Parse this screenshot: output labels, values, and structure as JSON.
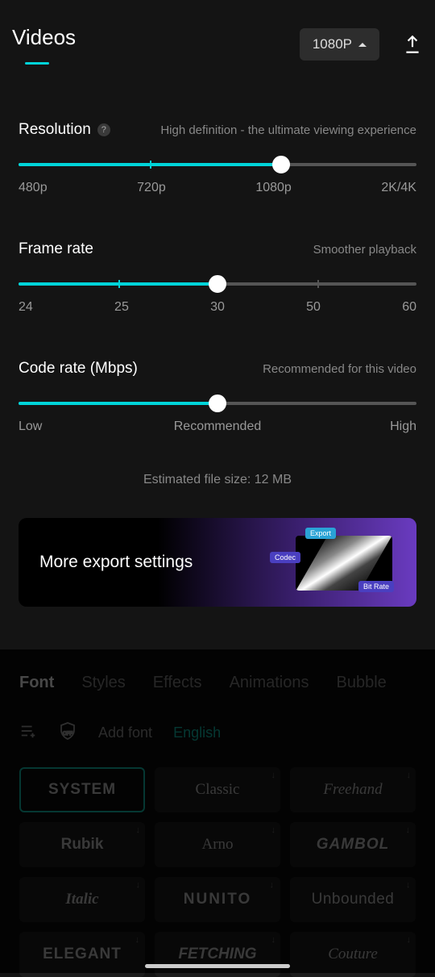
{
  "header": {
    "tab": "Videos",
    "resolution_chip": "1080P"
  },
  "resolution": {
    "title": "Resolution",
    "help": "?",
    "hint": "High definition - the ultimate viewing experience",
    "labels": [
      "480p",
      "720p",
      "1080p",
      "2K/4K"
    ]
  },
  "framerate": {
    "title": "Frame rate",
    "hint": "Smoother playback",
    "labels": [
      "24",
      "25",
      "30",
      "50",
      "60"
    ]
  },
  "coderate": {
    "title": "Code rate (Mbps)",
    "hint": "Recommended for this video",
    "labels": {
      "low": "Low",
      "mid": "Recommended",
      "high": "High"
    }
  },
  "estimate": "Estimated file size: 12 MB",
  "more_card": {
    "text": "More export settings",
    "tag_export": "Export",
    "tag_codec": "Codec",
    "tag_bitrate": "Bit Rate"
  },
  "font_tabs": [
    "Font",
    "Styles",
    "Effects",
    "Animations",
    "Bubble"
  ],
  "font_bar": {
    "add_font": "Add font",
    "lang": "English"
  },
  "fonts": [
    "SYSTEM",
    "Classic",
    "Freehand",
    "Rubik",
    "Arno",
    "GAMBOL",
    "Italic",
    "NUNITO",
    "Unbounded",
    "ELEGANT",
    "FETCHING",
    "Couture"
  ],
  "font_styles": {
    "0": "font-weight:600;letter-spacing:1px",
    "1": "font-family:Georgia,serif",
    "2": "font-style:italic;font-family:cursive",
    "3": "font-weight:700",
    "4": "font-family:'Times New Roman',serif",
    "5": "font-weight:700;font-style:italic;letter-spacing:1px",
    "6": "font-style:italic;font-family:Georgia,serif;font-weight:600",
    "7": "font-weight:600;letter-spacing:2px",
    "8": "font-weight:300;letter-spacing:0.5px",
    "9": "font-weight:800;letter-spacing:1px",
    "10": "font-weight:700;font-style:italic",
    "11": "font-family:cursive;font-style:italic"
  }
}
